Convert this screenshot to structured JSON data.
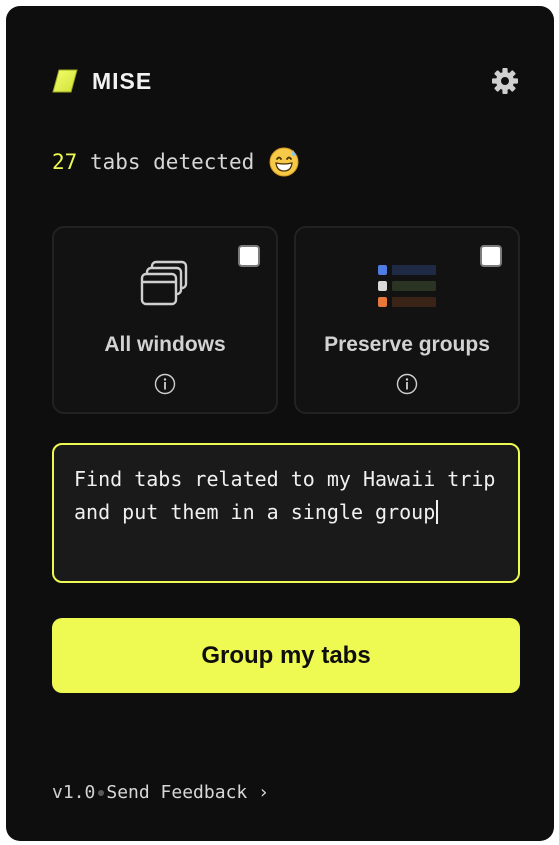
{
  "app": {
    "name": "MISE",
    "accent_color": "#eefa52",
    "background_color": "#0e0e0e"
  },
  "header": {
    "logo_icon": "yellow-tag-icon",
    "settings_icon": "gear-icon"
  },
  "status": {
    "count": "27",
    "text": "tabs detected",
    "emoji_icon": "grinning-sweat-emoji-icon"
  },
  "options": [
    {
      "label": "All windows",
      "icon": "stacked-windows-icon",
      "checked": false
    },
    {
      "label": "Preserve groups",
      "icon": "tab-groups-icon",
      "checked": false,
      "group_colors": [
        "#4f7ce0",
        "#d9d9d9",
        "#e8773a"
      ]
    }
  ],
  "prompt": {
    "value": "Find tabs related to my Hawaii trip and put them in a single group"
  },
  "primary_button": {
    "label": "Group my tabs"
  },
  "footer": {
    "version": "v1.0",
    "feedback_label": "Send Feedback ›"
  }
}
